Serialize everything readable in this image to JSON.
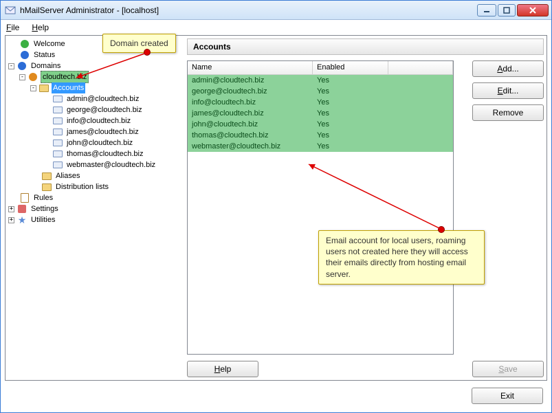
{
  "window": {
    "title": "hMailServer Administrator - [localhost]"
  },
  "menu": {
    "file": "File",
    "help": "Help"
  },
  "tree": {
    "welcome": "Welcome",
    "status": "Status",
    "domains": "Domains",
    "domain_name": "cloudtech.biz",
    "accounts": "Accounts",
    "account_items": [
      "admin@cloudtech.biz",
      "george@cloudtech.biz",
      "info@cloudtech.biz",
      "james@cloudtech.biz",
      "john@cloudtech.biz",
      "thomas@cloudtech.biz",
      "webmaster@cloudtech.biz"
    ],
    "aliases": "Aliases",
    "distribution_lists": "Distribution lists",
    "rules": "Rules",
    "settings": "Settings",
    "utilities": "Utilities"
  },
  "panel": {
    "title": "Accounts",
    "col_name": "Name",
    "col_enabled": "Enabled",
    "rows": [
      {
        "name": "admin@cloudtech.biz",
        "enabled": "Yes"
      },
      {
        "name": "george@cloudtech.biz",
        "enabled": "Yes"
      },
      {
        "name": "info@cloudtech.biz",
        "enabled": "Yes"
      },
      {
        "name": "james@cloudtech.biz",
        "enabled": "Yes"
      },
      {
        "name": "john@cloudtech.biz",
        "enabled": "Yes"
      },
      {
        "name": "thomas@cloudtech.biz",
        "enabled": "Yes"
      },
      {
        "name": "webmaster@cloudtech.biz",
        "enabled": "Yes"
      }
    ]
  },
  "buttons": {
    "add": "Add...",
    "edit": "Edit...",
    "remove": "Remove",
    "help": "Help",
    "save": "Save",
    "exit": "Exit"
  },
  "callouts": {
    "domain": "Domain created",
    "email": "Email account for local users, roaming users not created here they will access their emails directly from hosting email server."
  }
}
